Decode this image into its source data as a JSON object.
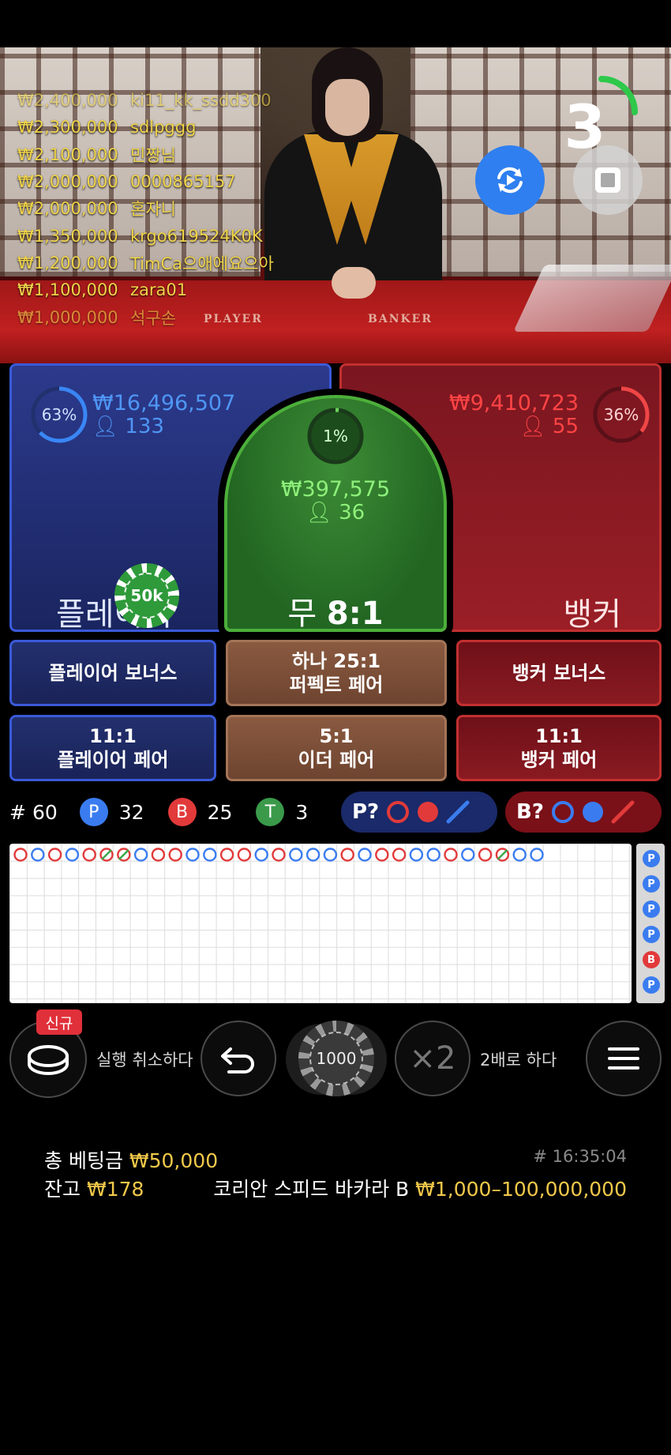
{
  "leaderboard": [
    {
      "amount": "₩2,400,000",
      "name": "ki11_kk_ssdd300"
    },
    {
      "amount": "₩2,300,000",
      "name": "sdlpggg"
    },
    {
      "amount": "₩2,100,000",
      "name": "민짱님"
    },
    {
      "amount": "₩2,000,000",
      "name": "0000865157"
    },
    {
      "amount": "₩2,000,000",
      "name": "혼자니"
    },
    {
      "amount": "₩1,350,000",
      "name": "krgo619524K0K"
    },
    {
      "amount": "₩1,200,000",
      "name": "TimCa으애에요으아"
    },
    {
      "amount": "₩1,100,000",
      "name": "zara01"
    },
    {
      "amount": "₩1,000,000",
      "name": "석구손"
    }
  ],
  "table_labels": {
    "player": "PLAYER",
    "banker": "BANKER"
  },
  "countdown": "3",
  "bets": {
    "player": {
      "percent": "63%",
      "percent_value": 0.63,
      "amount": "₩16,496,507",
      "players": "133",
      "label": "플레이어",
      "chip": "50k"
    },
    "tie": {
      "percent": "1%",
      "percent_value": 0.01,
      "amount": "₩397,575",
      "players": "36",
      "label": "무",
      "odds": "8:1"
    },
    "banker": {
      "percent": "36%",
      "percent_value": 0.36,
      "amount": "₩9,410,723",
      "players": "55",
      "label": "뱅커"
    }
  },
  "side_bets": {
    "player_bonus": [
      "플레이어 보너스"
    ],
    "perfect_pair": [
      "하나 25:1",
      "퍼펙트 페어"
    ],
    "banker_bonus": [
      "뱅커 보너스"
    ],
    "player_pair": [
      "11:1",
      "플레이어 페어"
    ],
    "either_pair": [
      "5:1",
      "이더 페어"
    ],
    "banker_pair": [
      "11:1",
      "뱅커 페어"
    ]
  },
  "stats": {
    "round_prefix": "#",
    "round": "60",
    "player_badge": "P",
    "player_wins": "32",
    "banker_badge": "B",
    "banker_wins": "25",
    "tie_badge": "T",
    "ties": "3"
  },
  "predict": {
    "player": "P?",
    "banker": "B?"
  },
  "roadmap": {
    "top_row": [
      "B",
      "P",
      "B",
      "P",
      "B",
      "T",
      "T",
      "P",
      "B",
      "B",
      "P",
      "P",
      "B",
      "B",
      "P",
      "B",
      "P",
      "P",
      "P",
      "B",
      "P",
      "B",
      "B",
      "P",
      "P",
      "B",
      "P",
      "B",
      "T",
      "P",
      "P"
    ],
    "side": [
      "P",
      "P",
      "P",
      "P",
      "B",
      "P"
    ]
  },
  "controls": {
    "new_badge": "신규",
    "undo_label": "실행 취소하다",
    "chip_value": "1000",
    "double_icon": "×2",
    "double_label": "2배로 하다"
  },
  "footer": {
    "total_bet_label": "총 베팅금",
    "total_bet": "₩50,000",
    "balance_label": "잔고",
    "balance": "₩178",
    "round_id": "# 16:35:04",
    "table_name": "코리안 스피드 바카라 B",
    "limits": "₩1,000–100,000,000"
  },
  "colors": {
    "player": "#3a7cf0",
    "banker": "#e23a3a",
    "tie": "#4caf3a",
    "gold": "#f2c94a"
  }
}
